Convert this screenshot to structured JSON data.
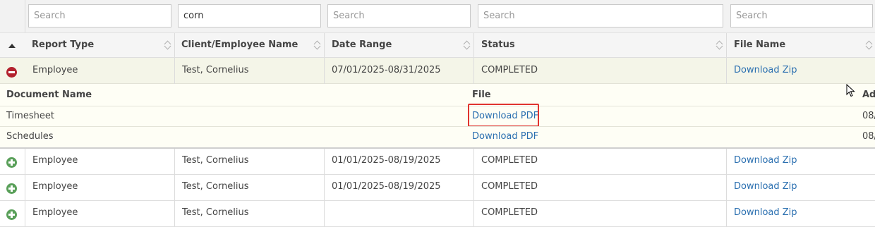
{
  "search": {
    "report_type": {
      "value": "",
      "placeholder": "Search"
    },
    "client_name": {
      "value": "corn",
      "placeholder": "Search"
    },
    "date_range": {
      "value": "",
      "placeholder": "Search"
    },
    "status": {
      "value": "",
      "placeholder": "Search"
    },
    "file_name": {
      "value": "",
      "placeholder": "Search"
    }
  },
  "headers": {
    "report_type": "Report Type",
    "client_name": "Client/Employee Name",
    "date_range": "Date Range",
    "status": "Status",
    "file_name": "File Name"
  },
  "expanded_row": {
    "report_type": "Employee",
    "client_name": "Test, Cornelius",
    "date_range": "07/01/2025-08/31/2025",
    "status": "COMPLETED",
    "file_link": "Download Zip"
  },
  "subtable": {
    "headers": {
      "document_name": "Document Name",
      "file": "File",
      "added": "Ad"
    },
    "rows": [
      {
        "document_name": "Timesheet",
        "file_link": "Download PDF",
        "added": "08/"
      },
      {
        "document_name": "Schedules",
        "file_link": "Download PDF",
        "added": "08/"
      }
    ]
  },
  "rows": [
    {
      "report_type": "Employee",
      "client_name": "Test, Cornelius",
      "date_range": "01/01/2025-08/19/2025",
      "status": "COMPLETED",
      "file_link": "Download Zip"
    },
    {
      "report_type": "Employee",
      "client_name": "Test, Cornelius",
      "date_range": "01/01/2025-08/19/2025",
      "status": "COMPLETED",
      "file_link": "Download Zip"
    },
    {
      "report_type": "Employee",
      "client_name": "Test, Cornelius",
      "date_range": "",
      "status": "COMPLETED",
      "file_link": "Download Zip"
    }
  ],
  "colors": {
    "link": "#2a6fb0",
    "collapse_icon": "#b3222e",
    "expand_icon": "#5aa05a",
    "highlight": "#e0342f",
    "expanded_bg": "#f4f5e8"
  }
}
